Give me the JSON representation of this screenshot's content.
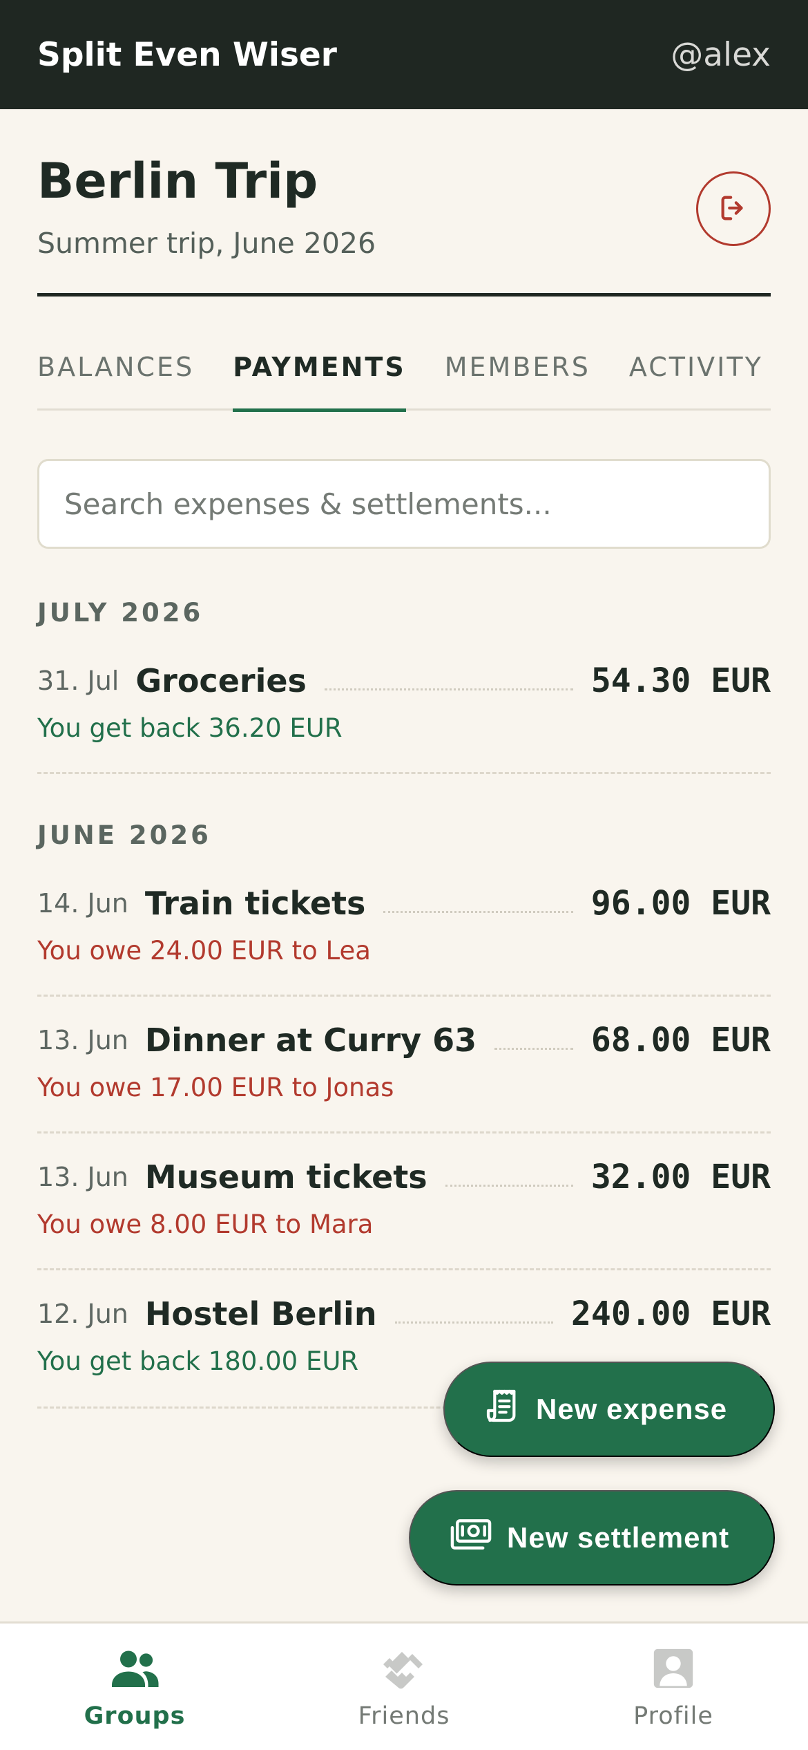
{
  "topbar": {
    "app_title": "Split Even Wiser",
    "username": "@alex"
  },
  "group": {
    "title": "Berlin Trip",
    "subtitle": "Summer trip, June 2026",
    "leave_icon": "logout-icon"
  },
  "tabs": [
    {
      "label": "BALANCES",
      "active": false
    },
    {
      "label": "PAYMENTS",
      "active": true
    },
    {
      "label": "MEMBERS",
      "active": false
    },
    {
      "label": "ACTIVITY",
      "active": false
    }
  ],
  "search": {
    "placeholder": "Search expenses & settlements...",
    "value": ""
  },
  "months": [
    {
      "label": "JULY 2026",
      "entries": [
        {
          "date": "31. Jul",
          "name": "Groceries",
          "amount": "54.30 EUR",
          "note": "You get back 36.20 EUR",
          "tone": "positive"
        }
      ]
    },
    {
      "label": "JUNE 2026",
      "entries": [
        {
          "date": "14. Jun",
          "name": "Train tickets",
          "amount": "96.00 EUR",
          "note": "You owe 24.00 EUR to Lea",
          "tone": "negative"
        },
        {
          "date": "13. Jun",
          "name": "Dinner at Curry 63",
          "amount": "68.00 EUR",
          "note": "You owe 17.00 EUR to Jonas",
          "tone": "negative"
        },
        {
          "date": "13. Jun",
          "name": "Museum tickets",
          "amount": "32.00 EUR",
          "note": "You owe 8.00 EUR to Mara",
          "tone": "negative"
        },
        {
          "date": "12. Jun",
          "name": "Hostel Berlin",
          "amount": "240.00 EUR",
          "note": "You get back 180.00 EUR",
          "tone": "positive"
        }
      ]
    }
  ],
  "fabs": {
    "new_expense": {
      "label": "New expense",
      "icon": "receipt-icon"
    },
    "new_settlement": {
      "label": "New settlement",
      "icon": "cash-icon"
    }
  },
  "bottomnav": [
    {
      "label": "Groups",
      "icon": "groups-icon",
      "active": true
    },
    {
      "label": "Friends",
      "icon": "handshake-icon",
      "active": false
    },
    {
      "label": "Profile",
      "icon": "profile-icon",
      "active": false
    }
  ],
  "colors": {
    "accent": "#22704b",
    "negative": "#b23a2e",
    "topbar": "#1f2722",
    "background": "#f9f5ee"
  }
}
